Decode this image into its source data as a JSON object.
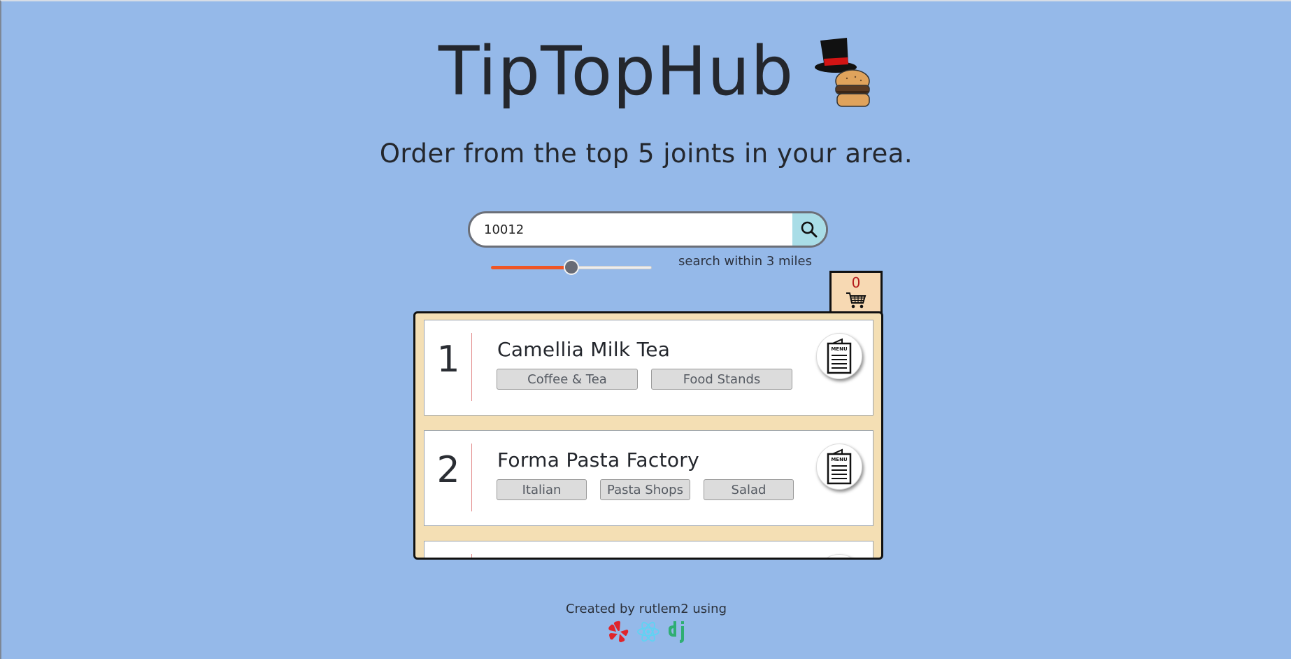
{
  "app": {
    "title": "TipTopHub",
    "subtitle": "Order from the top 5 joints in your area."
  },
  "search": {
    "value": "10012",
    "placeholder": "",
    "button_icon": "search-icon"
  },
  "radius": {
    "label": "search within 3 miles",
    "value_fraction": 0.5
  },
  "cart": {
    "count": "0",
    "icon": "cart-icon"
  },
  "restaurants": [
    {
      "rank": "1",
      "name": "Camellia Milk Tea",
      "tags": [
        "Coffee & Tea",
        "Food Stands"
      ],
      "menu_label": "MENU"
    },
    {
      "rank": "2",
      "name": "Forma Pasta Factory",
      "tags": [
        "Italian",
        "Pasta Shops",
        "Salad"
      ],
      "menu_label": "MENU"
    },
    {
      "rank": "",
      "name": "",
      "tags": [],
      "menu_label": ""
    }
  ],
  "footer": {
    "text": "Created by rutlem2 using",
    "icons": [
      "yelp-icon",
      "react-icon",
      "django-icon"
    ]
  },
  "colors": {
    "background": "#95b9e9",
    "list_bg": "#f4dfb4",
    "slider_fill": "#ef5626",
    "cart_count": "#b31b1b",
    "search_button": "#a9dde7"
  }
}
